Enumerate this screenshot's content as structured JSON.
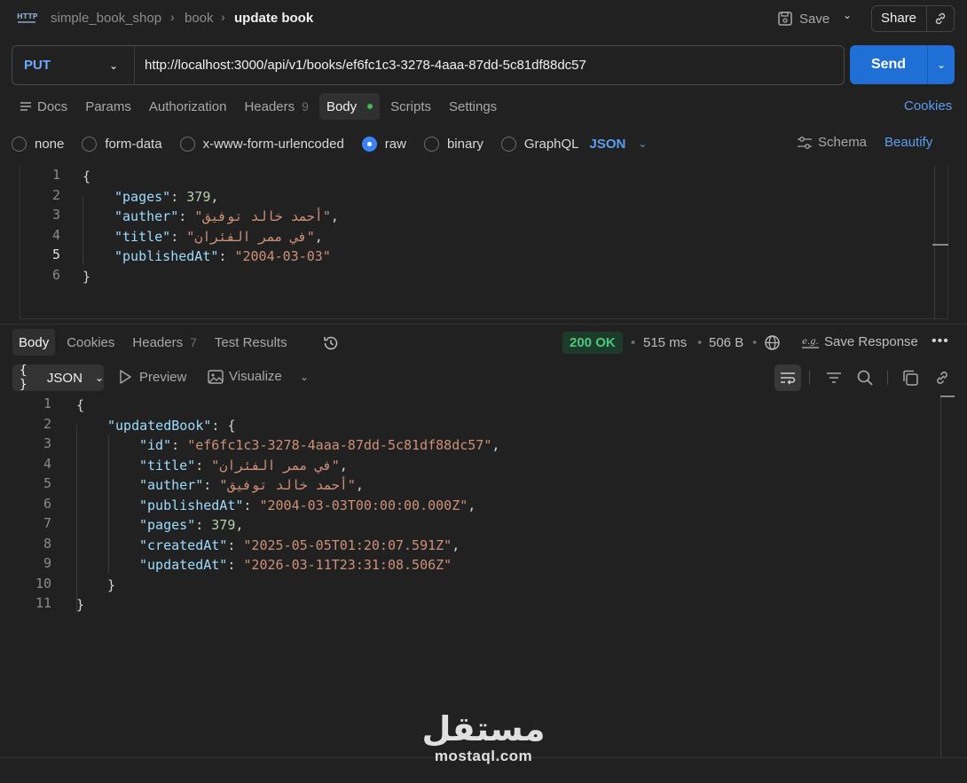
{
  "breadcrumb": [
    "simple_book_shop",
    "book",
    "update book"
  ],
  "toolbar": {
    "save_label": "Save",
    "share_label": "Share"
  },
  "request": {
    "method": "PUT",
    "url": "http://localhost:3000/api/v1/books/ef6fc1c3-3278-4aaa-87dd-5c81df88dc57",
    "send_label": "Send",
    "tabs": [
      {
        "label": "Docs"
      },
      {
        "label": "Params"
      },
      {
        "label": "Authorization"
      },
      {
        "label": "Headers",
        "count": "9"
      },
      {
        "label": "Body",
        "active": true
      },
      {
        "label": "Scripts"
      },
      {
        "label": "Settings"
      }
    ],
    "cookies_label": "Cookies",
    "body_types": [
      "none",
      "form-data",
      "x-www-form-urlencoded",
      "raw",
      "binary",
      "GraphQL"
    ],
    "selected_body_type": "raw",
    "format": "JSON",
    "schema_label": "Schema",
    "beautify_label": "Beautify",
    "line_numbers": [
      "1",
      "2",
      "3",
      "4",
      "5",
      "6"
    ],
    "body": {
      "open": "{",
      "close": "}",
      "pages_key": "\"pages\"",
      "pages_val": "379",
      "auther_key": "\"auther\"",
      "auther_val": "\"أحمد خالد توفيق\"",
      "title_key": "\"title\"",
      "title_val": "\"في ممر الفئران\"",
      "published_key": "\"publishedAt\"",
      "published_val": "\"2004-03-03\""
    }
  },
  "response": {
    "tabs": [
      {
        "label": "Body",
        "active": true
      },
      {
        "label": "Cookies"
      },
      {
        "label": "Headers",
        "count": "7"
      },
      {
        "label": "Test Results"
      }
    ],
    "status": "200 OK",
    "time": "515 ms",
    "size": "506 B",
    "save_response_label": "Save Response",
    "format": "JSON",
    "preview_label": "Preview",
    "visualize_label": "Visualize",
    "line_numbers": [
      "1",
      "2",
      "3",
      "4",
      "5",
      "6",
      "7",
      "8",
      "9",
      "10",
      "11"
    ],
    "body": {
      "open": "{",
      "close": "}",
      "updated_key": "\"updatedBook\"",
      "inner_open": "{",
      "inner_close": "}",
      "id_key": "\"id\"",
      "id_val": "\"ef6fc1c3-3278-4aaa-87dd-5c81df88dc57\"",
      "title_key": "\"title\"",
      "title_val": "\"في ممر الفئران\"",
      "auther_key": "\"auther\"",
      "auther_val": "\"أحمد خالد توفيق\"",
      "published_key": "\"publishedAt\"",
      "published_val": "\"2004-03-03T00:00:00.000Z\"",
      "pages_key": "\"pages\"",
      "pages_val": "379",
      "created_key": "\"createdAt\"",
      "created_val": "\"2025-05-05T01:20:07.591Z\"",
      "updated_at_key": "\"updatedAt\"",
      "updated_at_val": "\"2026-03-11T23:31:08.506Z\""
    }
  },
  "watermark": {
    "logo": "مستقل",
    "url": "mostaql.com"
  },
  "colors": {
    "accent": "#1f6fd6",
    "link": "#5b9df0",
    "success": "#4ec77c",
    "key": "#9cdcfe",
    "string": "#ce9178",
    "number": "#b5cea8"
  }
}
